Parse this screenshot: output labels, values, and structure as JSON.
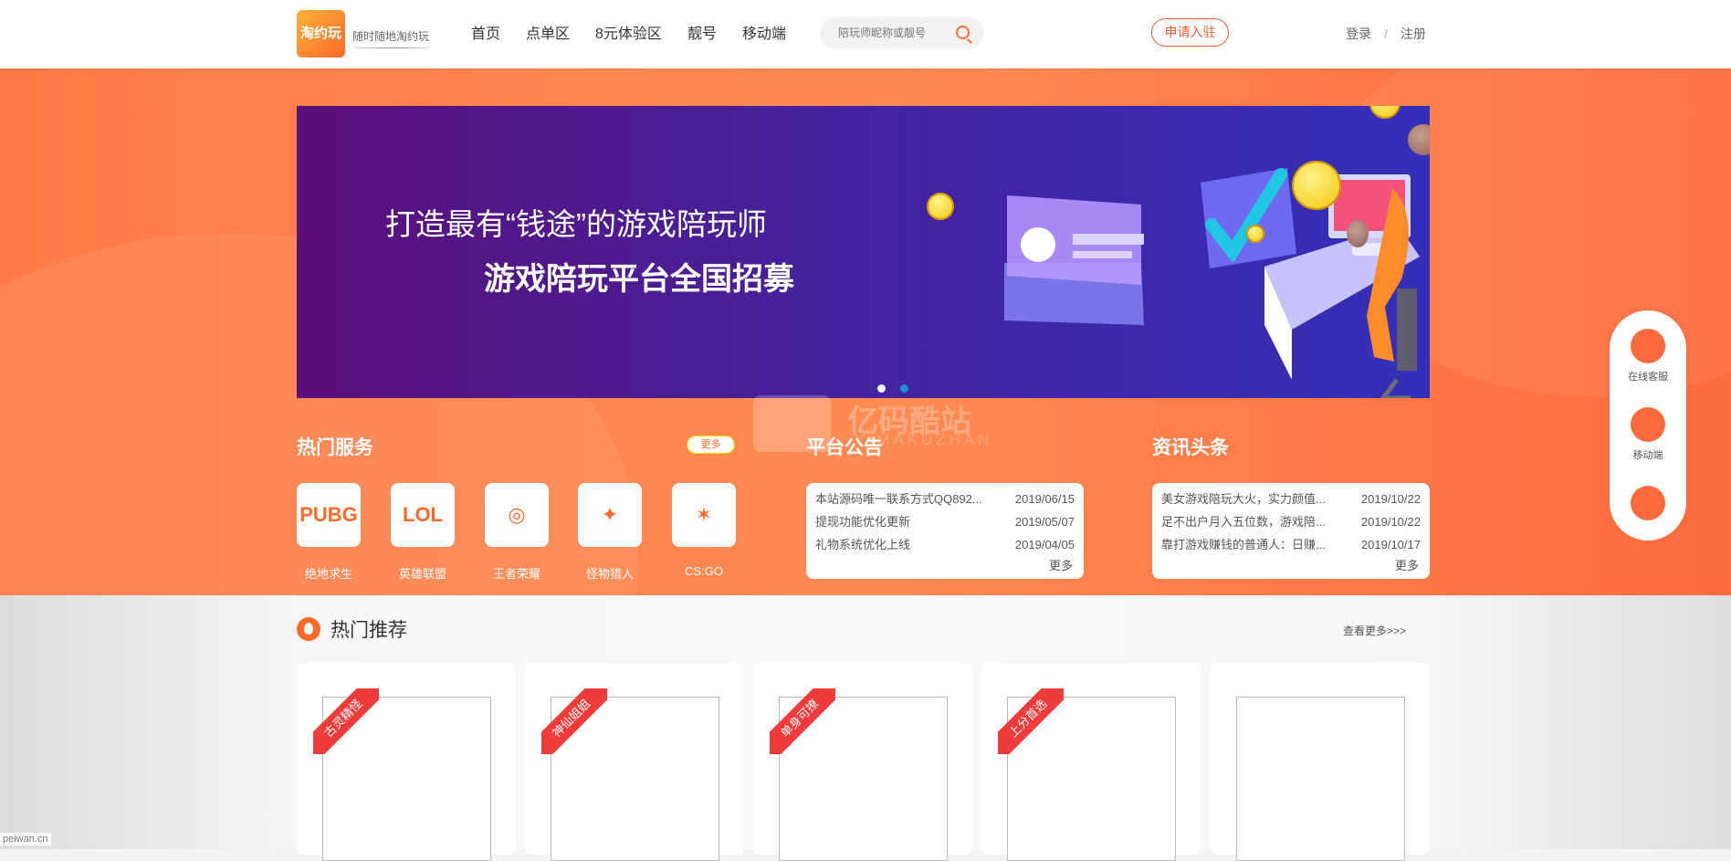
{
  "brand": {
    "logo_text": "淘约玩",
    "slogan": "随时随地淘约玩"
  },
  "nav": [
    {
      "label": "首页"
    },
    {
      "label": "点单区"
    },
    {
      "label": "8元体验区"
    },
    {
      "label": "靓号"
    },
    {
      "label": "移动端"
    }
  ],
  "search": {
    "placeholder": "陪玩师昵称或靓号"
  },
  "header": {
    "apply_label": "申请入驻",
    "login_label": "登录",
    "separator": "/",
    "register_label": "注册"
  },
  "banner": {
    "headline": "打造最有“钱途”的游戏陪玩师",
    "subheadline": "游戏陪玩平台全国招募",
    "dot_colors": [
      "#ffffff",
      "#1d8fd3"
    ]
  },
  "hot_services": {
    "title": "热门服务",
    "more_label": "更多",
    "games": [
      {
        "icon_text": "PUBG",
        "name": "绝地求生"
      },
      {
        "icon_text": "LOL",
        "name": "英雄联盟"
      },
      {
        "icon_text": "◎",
        "name": "王者荣耀"
      },
      {
        "icon_text": "✦",
        "name": "怪物猎人"
      },
      {
        "icon_text": "✶",
        "name": "CS:GO"
      }
    ]
  },
  "announcements": {
    "title": "平台公告",
    "more_label": "更多",
    "items": [
      {
        "text": "本站源码唯一联系方式QQ892...",
        "date": "2019/06/15"
      },
      {
        "text": "提现功能优化更新",
        "date": "2019/05/07"
      },
      {
        "text": "礼物系统优化上线",
        "date": "2019/04/05"
      }
    ]
  },
  "news": {
    "title": "资讯头条",
    "more_label": "更多",
    "items": [
      {
        "text": "美女游戏陪玩大火，实力颜值...",
        "date": "2019/10/22"
      },
      {
        "text": "足不出户月入五位数，游戏陪...",
        "date": "2019/10/22"
      },
      {
        "text": "靠打游戏赚钱的普通人：日赚...",
        "date": "2019/10/17"
      }
    ]
  },
  "recommend": {
    "title": "热门推荐",
    "see_more": "查看更多>>>",
    "cards": [
      {
        "ribbon": "古灵精怪"
      },
      {
        "ribbon": "神仙姐姐"
      },
      {
        "ribbon": "单身可撩"
      },
      {
        "ribbon": "上分首选"
      },
      {
        "ribbon": ""
      }
    ]
  },
  "side_panel": {
    "service_label": "在线客服",
    "mobile_label": "移动端"
  },
  "watermark": {
    "text": "亿码酷站",
    "sub": "YIMAKUZHAN"
  },
  "footer": {
    "url": "peiwan.cn"
  },
  "colors": {
    "accent": "#ff6a2a",
    "ribbon": "#f13a3a"
  }
}
